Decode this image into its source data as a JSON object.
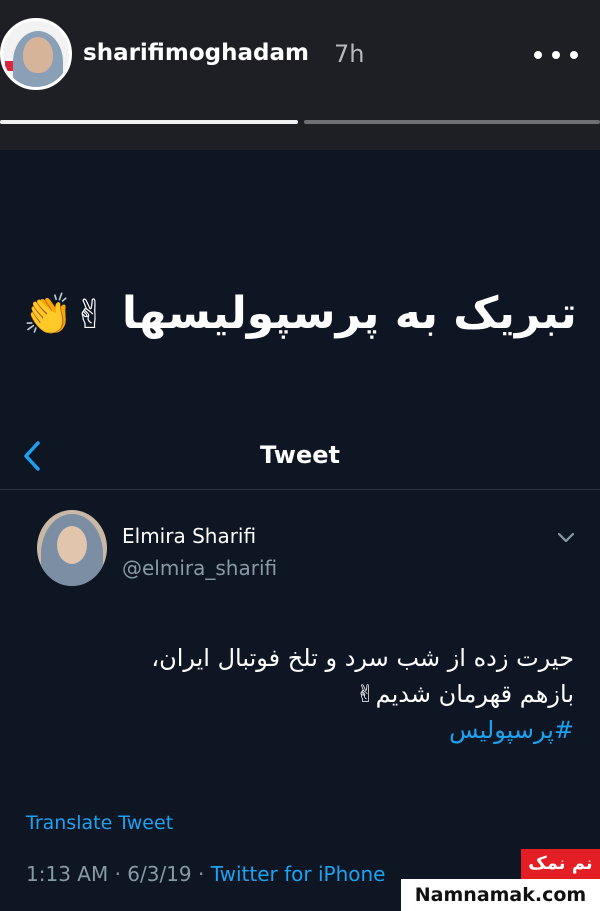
{
  "story": {
    "username": "sharifimoghadam",
    "time_ago": "7h",
    "progress": [
      1.0,
      0.0
    ]
  },
  "caption": {
    "text": "تبریک به پرسپولیسها",
    "emoji": "✌👏"
  },
  "tweet_nav": {
    "title": "Tweet"
  },
  "tweet": {
    "author_name": "Elmira Sharifi",
    "author_handle": "@elmira_sharifi",
    "body_line1": "حیرت زده از شب سرد و تلخ فوتبال ایران،",
    "body_line2": "بازهم قهرمان شدیم✌",
    "hashtag": "#پرسپولیس",
    "translate_label": "Translate Tweet",
    "time_date": "1:13 AM · 6/3/19 · ",
    "source": "Twitter for iPhone"
  },
  "watermark": {
    "red_text": "نم نمک",
    "site": "Namnamak.com"
  },
  "colors": {
    "background": "#0f1623",
    "accent": "#1da1f2",
    "watermark_red": "#e31e24"
  }
}
